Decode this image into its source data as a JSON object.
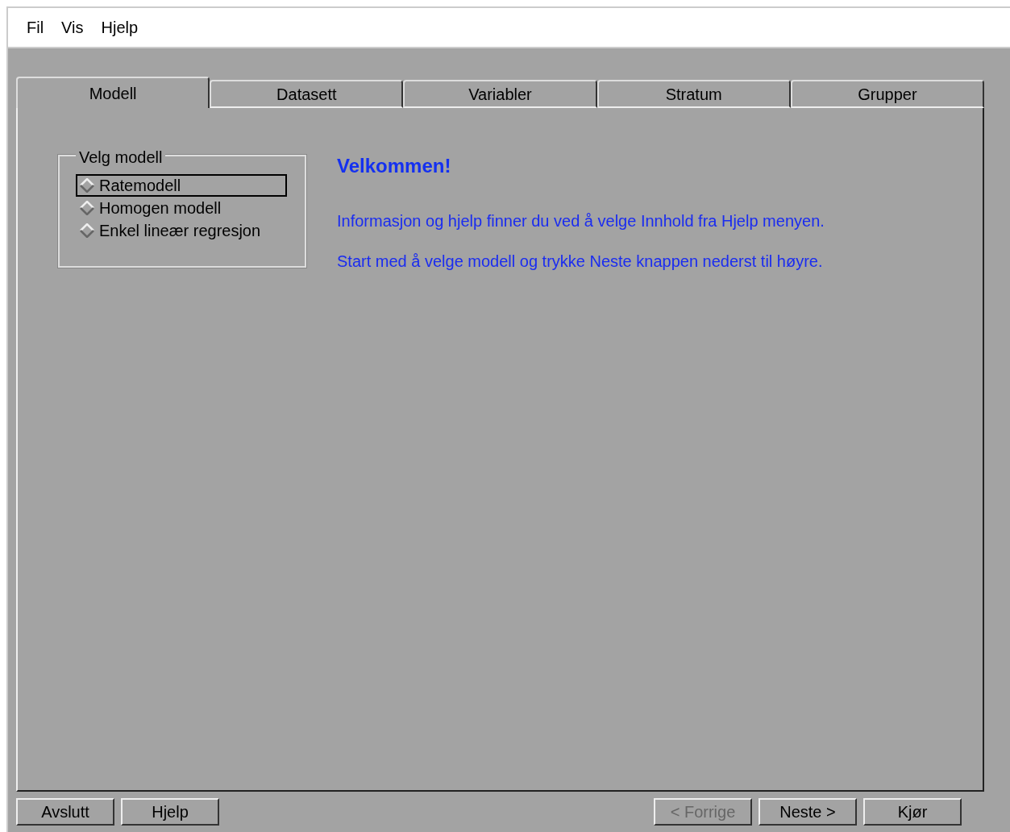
{
  "menu": [
    "Fil",
    "Vis",
    "Hjelp"
  ],
  "tabs": [
    {
      "label": "Modell",
      "selected": true
    },
    {
      "label": "Datasett",
      "selected": false
    },
    {
      "label": "Variabler",
      "selected": false
    },
    {
      "label": "Stratum",
      "selected": false
    },
    {
      "label": "Grupper",
      "selected": false
    }
  ],
  "model_group": {
    "title": "Velg modell",
    "options": [
      {
        "label": "Ratemodell",
        "selected": false,
        "focused": true
      },
      {
        "label": "Homogen modell",
        "selected": false,
        "focused": false
      },
      {
        "label": "Enkel lineær regresjon",
        "selected": false,
        "focused": false
      }
    ]
  },
  "welcome": {
    "heading": "Velkommen!",
    "paragraphs": [
      "Informasjon og hjelp finner du ved å velge Innhold fra Hjelp menyen.",
      "Start med å velge modell og trykke Neste knappen nederst til høyre."
    ]
  },
  "left_buttons": [
    {
      "label": "Avslutt",
      "disabled": false
    },
    {
      "label": "Hjelp",
      "disabled": false
    }
  ],
  "right_buttons": [
    {
      "label": "< Forrige",
      "disabled": true
    },
    {
      "label": "Neste >",
      "disabled": false
    },
    {
      "label": "Kjør",
      "disabled": false
    }
  ]
}
